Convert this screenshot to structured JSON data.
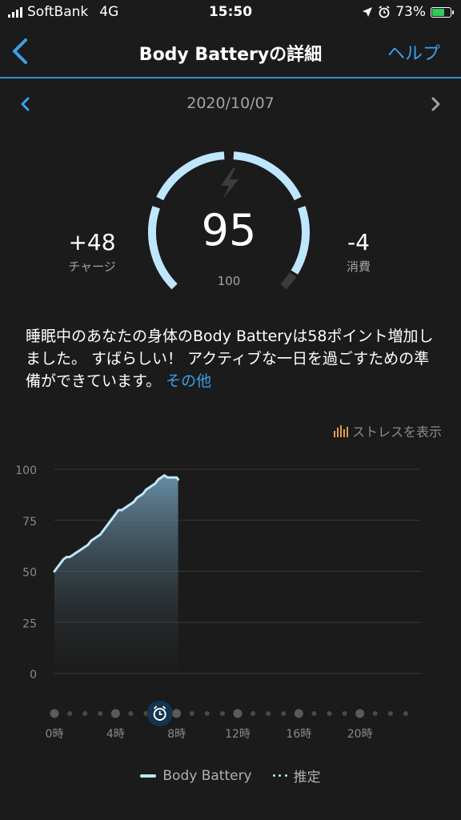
{
  "status_bar": {
    "carrier": "SoftBank",
    "network": "4G",
    "time": "15:50",
    "battery_percent": "73%",
    "battery_level": 0.73,
    "icons": [
      "signal-icon",
      "location-icon",
      "alarm-icon",
      "battery-charging-icon"
    ]
  },
  "header": {
    "title": "Body Batteryの詳細",
    "help_label": "ヘルプ"
  },
  "date_nav": {
    "date": "2020/10/07"
  },
  "gauge": {
    "value": "95",
    "max_label": "100",
    "level": 0.95,
    "arc_color": "#bfe6ff"
  },
  "charge": {
    "value": "+48",
    "label": "チャージ"
  },
  "drain": {
    "value": "-4",
    "label": "消費"
  },
  "description": {
    "text": "睡眠中のあなたの身体のBody Batteryは58ポイント増加しました。 すばらしい！ アクティブな一日を過ごすための準備ができています。 ",
    "more_link": "その他"
  },
  "stress_toggle": {
    "label": "ストレスを表示"
  },
  "chart_data": {
    "type": "area",
    "y_ticks": [
      "100",
      "75",
      "50",
      "25",
      "0"
    ],
    "ylim": [
      0,
      100
    ],
    "xlim": [
      0,
      24
    ],
    "x_ticks": [
      "0時",
      "4時",
      "8時",
      "12時",
      "16時",
      "20時"
    ],
    "series": [
      {
        "name": "Body Battery",
        "points": [
          [
            0,
            50
          ],
          [
            0.2,
            52
          ],
          [
            0.4,
            54
          ],
          [
            0.6,
            56
          ],
          [
            0.8,
            57
          ],
          [
            1.0,
            57
          ],
          [
            1.2,
            58
          ],
          [
            1.4,
            59
          ],
          [
            1.6,
            60
          ],
          [
            1.8,
            61
          ],
          [
            2.0,
            62
          ],
          [
            2.2,
            63
          ],
          [
            2.4,
            65
          ],
          [
            2.6,
            66
          ],
          [
            2.8,
            67
          ],
          [
            3.0,
            68
          ],
          [
            3.2,
            70
          ],
          [
            3.4,
            72
          ],
          [
            3.6,
            74
          ],
          [
            3.8,
            76
          ],
          [
            4.0,
            78
          ],
          [
            4.2,
            80
          ],
          [
            4.4,
            80
          ],
          [
            4.6,
            81
          ],
          [
            4.8,
            82
          ],
          [
            5.0,
            83
          ],
          [
            5.2,
            84
          ],
          [
            5.4,
            86
          ],
          [
            5.6,
            87
          ],
          [
            5.8,
            88
          ],
          [
            6.0,
            90
          ],
          [
            6.2,
            91
          ],
          [
            6.4,
            92
          ],
          [
            6.6,
            93
          ],
          [
            6.8,
            95
          ],
          [
            7.0,
            96
          ],
          [
            7.2,
            97
          ],
          [
            7.4,
            96
          ],
          [
            7.6,
            96
          ],
          [
            7.8,
            96
          ],
          [
            8.0,
            96
          ],
          [
            8.1,
            95
          ]
        ]
      }
    ],
    "colors": {
      "line": "#bfe6ff",
      "area_top": "#5f8aa3",
      "grid": "#3a3a3a"
    }
  },
  "timeline": {
    "alarm_marker_hour": 6.9
  },
  "legend": {
    "measured_label": "Body Battery",
    "estimated_label": "推定"
  }
}
